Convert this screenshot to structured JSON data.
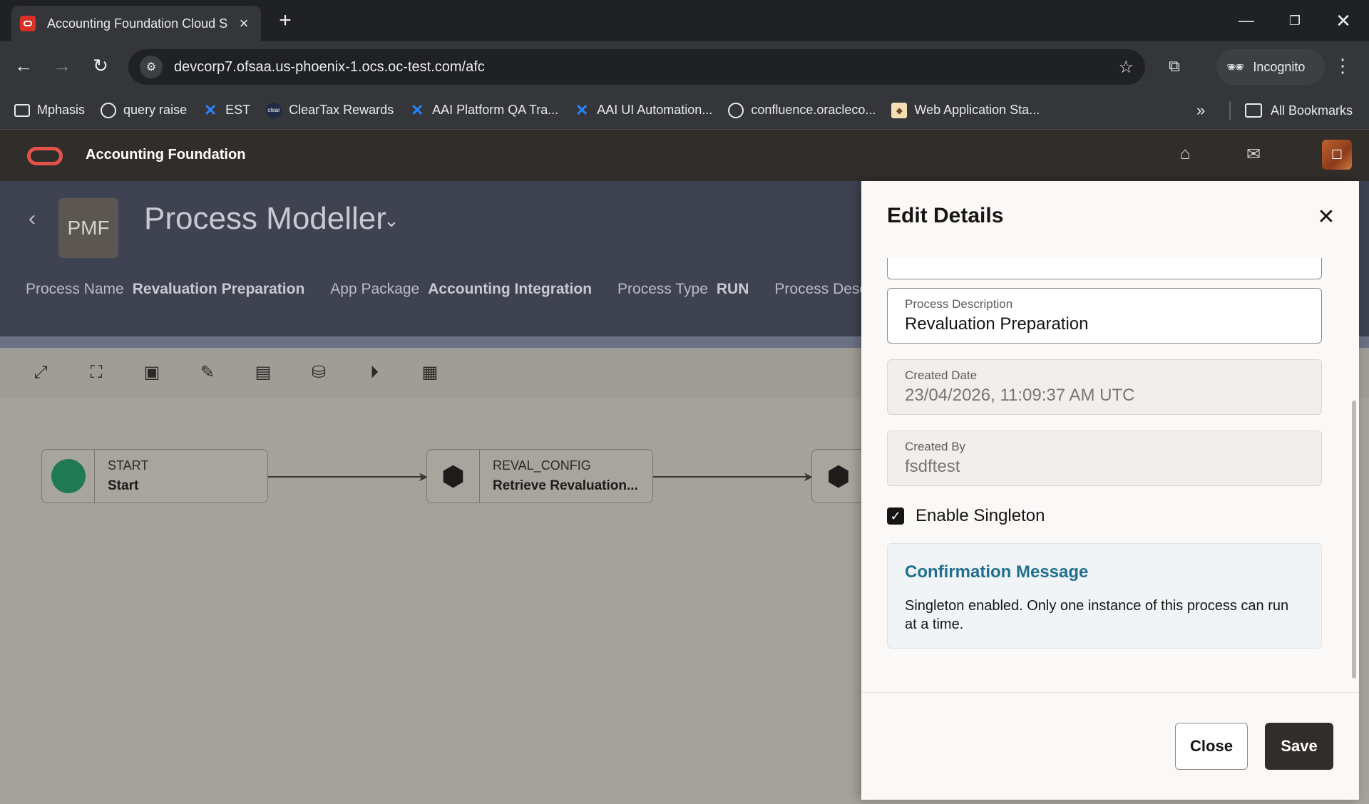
{
  "browser": {
    "tab_title": "Accounting Foundation Cloud S",
    "url": "devcorp7.ofsaa.us-phoenix-1.ocs.oc-test.com/afc",
    "incognito_label": "Incognito",
    "bookmarks": [
      {
        "label": "Mphasis",
        "icon": "folder-icon"
      },
      {
        "label": "query raise",
        "icon": "globe-icon"
      },
      {
        "label": "EST",
        "icon": "confluence-icon"
      },
      {
        "label": "ClearTax Rewards",
        "icon": "cleartax-icon"
      },
      {
        "label": "AAI Platform QA Tra...",
        "icon": "confluence-icon"
      },
      {
        "label": "AAI UI Automation...",
        "icon": "confluence-icon"
      },
      {
        "label": "confluence.oracleco...",
        "icon": "globe-icon"
      },
      {
        "label": "Web Application Sta...",
        "icon": "webapp-icon"
      }
    ],
    "all_bookmarks_label": "All Bookmarks"
  },
  "app": {
    "title": "Accounting Foundation",
    "avatar_icon": "user-avatar-icon"
  },
  "page": {
    "logo_text": "PMF",
    "title": "Process Modeller",
    "meta": {
      "process_name_label": "Process Name",
      "process_name_value": "Revaluation Preparation",
      "app_package_label": "App Package",
      "app_package_value": "Accounting Integration",
      "process_type_label": "Process Type",
      "process_type_value": "RUN",
      "process_description_label": "Process Descripti"
    },
    "nodes": [
      {
        "code": "START",
        "name": "Start",
        "icon": "start-circle-icon"
      },
      {
        "code": "REVAL_CONFIG",
        "name": "Retrieve Revaluation...",
        "icon": "cube-icon"
      },
      {
        "code": "",
        "name": "",
        "icon": "cube-icon"
      }
    ]
  },
  "drawer": {
    "title": "Edit Details",
    "fields": {
      "process_description_label": "Process Description",
      "process_description_value": "Revaluation Preparation",
      "created_date_label": "Created Date",
      "created_date_value": "23/04/2026, 11:09:37 AM UTC",
      "created_by_label": "Created By",
      "created_by_value": "fsdftest"
    },
    "singleton_label": "Enable Singleton",
    "singleton_checked": true,
    "confirmation": {
      "title": "Confirmation Message",
      "text": "Singleton enabled. Only one instance of this process can run at a time."
    },
    "close_label": "Close",
    "save_label": "Save"
  }
}
